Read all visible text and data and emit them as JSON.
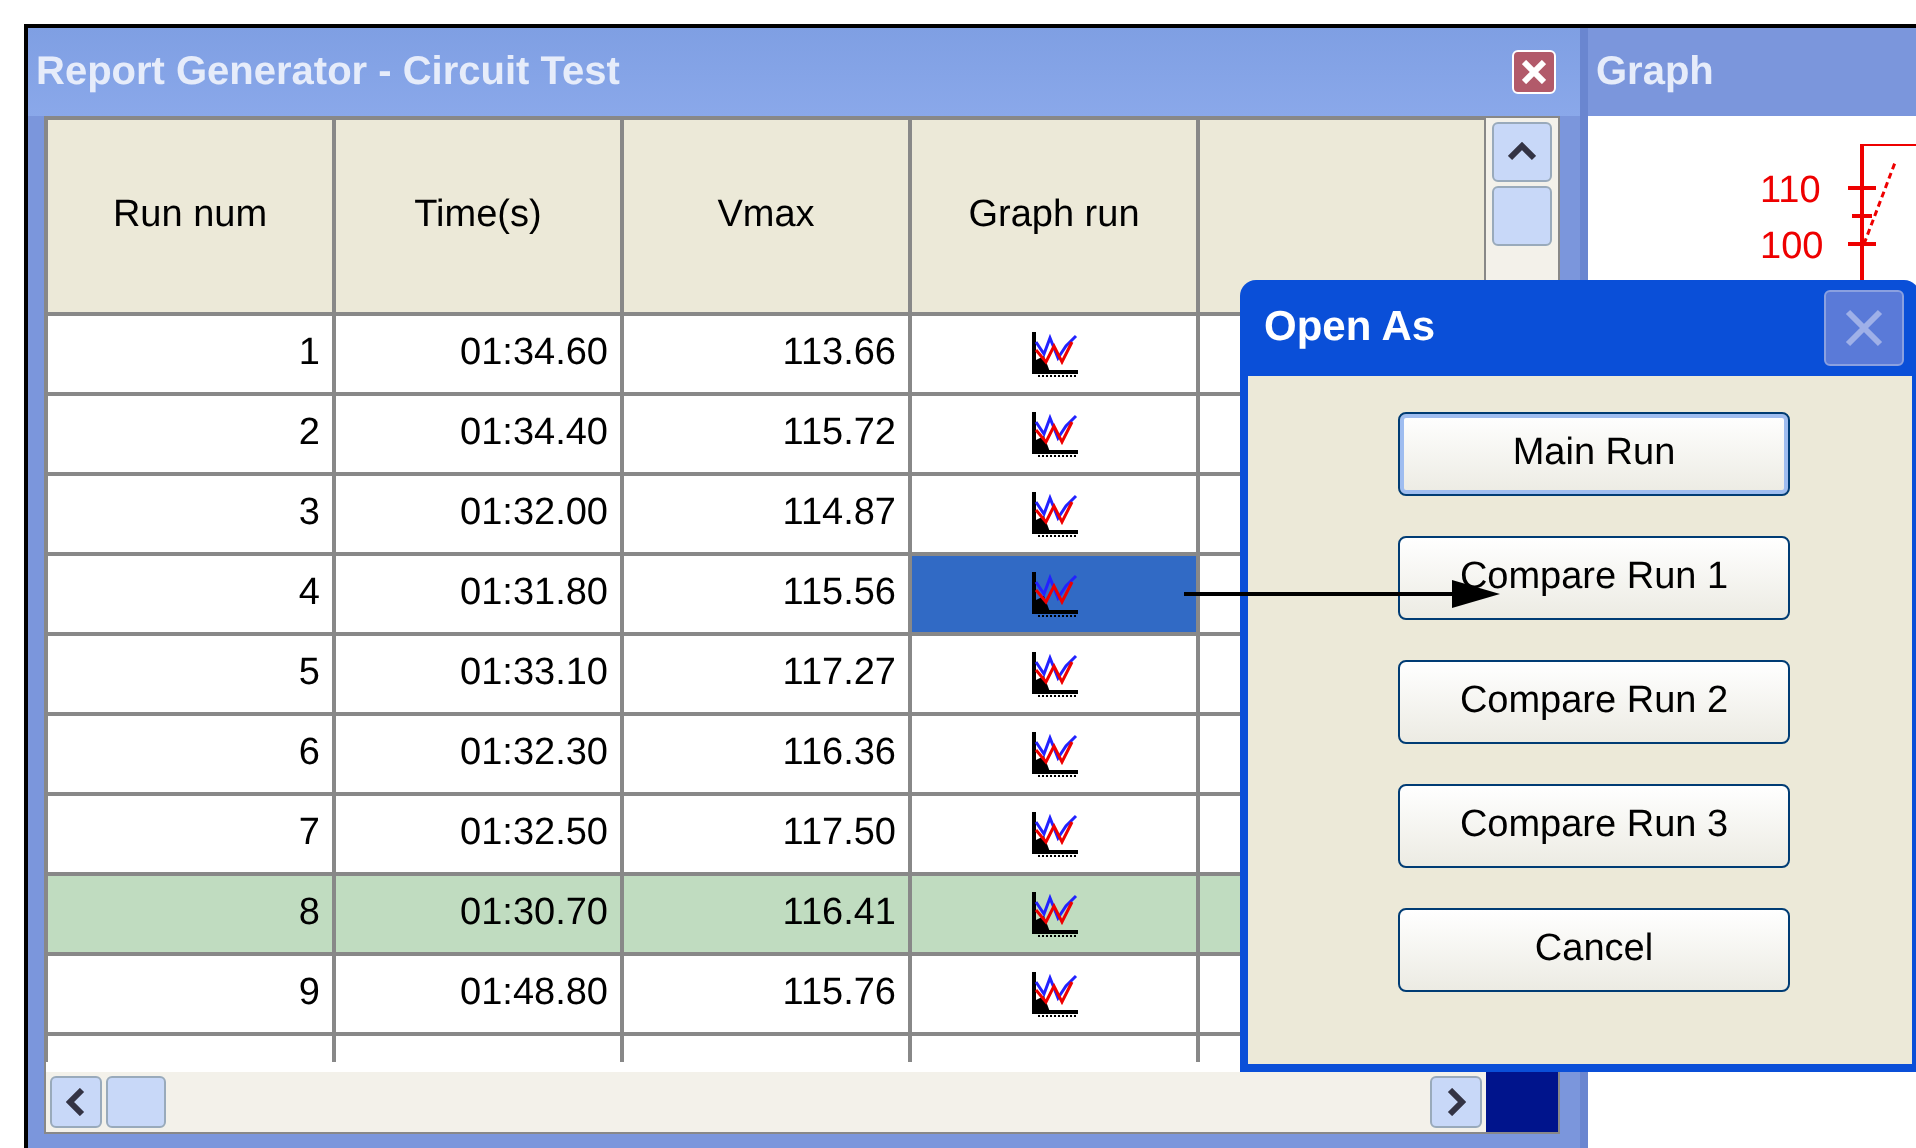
{
  "window": {
    "title": "Report Generator - Circuit Test"
  },
  "table": {
    "columns": [
      "Run num",
      "Time(s)",
      "Vmax",
      "Graph run"
    ],
    "rows": [
      {
        "run": "1",
        "time": "01:34.60",
        "vmax": "113.66",
        "selected": false,
        "graph_selected": false
      },
      {
        "run": "2",
        "time": "01:34.40",
        "vmax": "115.72",
        "selected": false,
        "graph_selected": false
      },
      {
        "run": "3",
        "time": "01:32.00",
        "vmax": "114.87",
        "selected": false,
        "graph_selected": false
      },
      {
        "run": "4",
        "time": "01:31.80",
        "vmax": "115.56",
        "selected": false,
        "graph_selected": true
      },
      {
        "run": "5",
        "time": "01:33.10",
        "vmax": "117.27",
        "selected": false,
        "graph_selected": false
      },
      {
        "run": "6",
        "time": "01:32.30",
        "vmax": "116.36",
        "selected": false,
        "graph_selected": false
      },
      {
        "run": "7",
        "time": "01:32.50",
        "vmax": "117.50",
        "selected": false,
        "graph_selected": false
      },
      {
        "run": "8",
        "time": "01:30.70",
        "vmax": "116.41",
        "selected": true,
        "graph_selected": false
      },
      {
        "run": "9",
        "time": "01:48.80",
        "vmax": "115.76",
        "selected": false,
        "graph_selected": false
      }
    ]
  },
  "graph_panel": {
    "title": "Graph",
    "ticks": [
      "110",
      "100"
    ]
  },
  "dialog": {
    "title": "Open As",
    "buttons": [
      {
        "label": "Main Run",
        "focused": true
      },
      {
        "label": "Compare Run 1",
        "focused": false
      },
      {
        "label": "Compare Run 2",
        "focused": false
      },
      {
        "label": "Compare Run 3",
        "focused": false
      },
      {
        "label": "Cancel",
        "focused": false
      }
    ]
  }
}
